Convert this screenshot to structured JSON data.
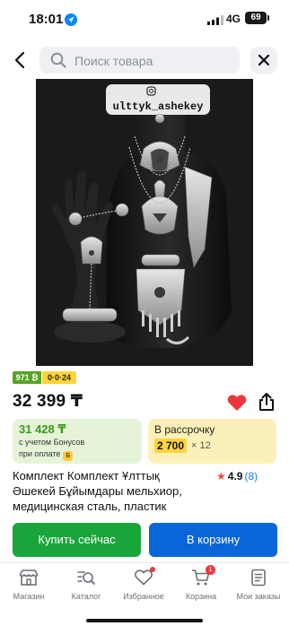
{
  "status_bar": {
    "time": "18:01",
    "network": "4G",
    "battery": "69"
  },
  "search": {
    "placeholder": "Поиск товара"
  },
  "product": {
    "image_watermark": "ulttyk_ashekey",
    "badges": {
      "green": "971 ₿",
      "yellow": "0·0·24"
    },
    "price": "32 399 ₸",
    "bonus": {
      "price": "31 428 ₸",
      "line1": "с учетом Бонусов",
      "line2": "при оплате",
      "coin": "Б"
    },
    "installment": {
      "title": "В рассрочку",
      "amount": "2 700",
      "multiplier": "× 12"
    },
    "title_lines": [
      "Комплект Комплект Ұлттық",
      "Әшекей Бұйымдары мельхиор,",
      "медицинская сталь, пластик"
    ],
    "rating": {
      "star": "★",
      "value": "4.9",
      "count": "(8)"
    }
  },
  "actions": {
    "buy_now": "Купить сейчас",
    "add_to_cart": "В корзину"
  },
  "tab_bar": {
    "items": [
      {
        "label": "Магазин",
        "icon": "store-icon"
      },
      {
        "label": "Каталог",
        "icon": "catalog-search-icon"
      },
      {
        "label": "Избранное",
        "icon": "heart-icon"
      },
      {
        "label": "Корзина",
        "icon": "cart-icon",
        "badge": "1"
      },
      {
        "label": "Мои заказы",
        "icon": "orders-icon"
      }
    ]
  },
  "colors": {
    "accent_green": "#1aa53b",
    "accent_blue": "#0866d8",
    "heart_red": "#e8383d"
  }
}
